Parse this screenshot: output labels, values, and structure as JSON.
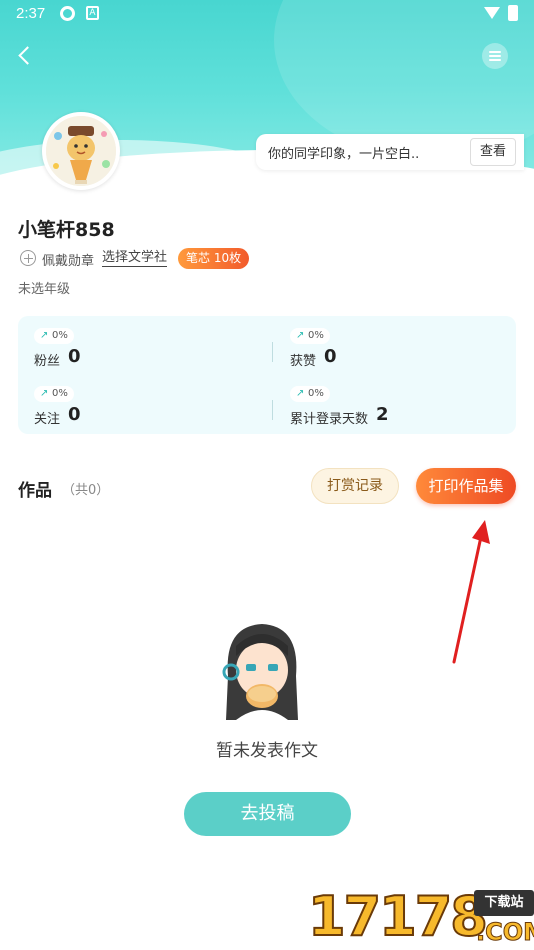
{
  "status_bar": {
    "time": "2:37",
    "app_badge": "A"
  },
  "impression": {
    "text": "你的同学印象，一片空白..",
    "view_label": "查看"
  },
  "profile": {
    "username": "小笔杆858",
    "medal_label": "佩戴勋章",
    "club_link": "选择文学社",
    "pen_badge": "笔芯 10枚",
    "grade": "未选年级"
  },
  "stats": [
    {
      "label": "粉丝",
      "value": "0",
      "trend": "0%"
    },
    {
      "label": "获赞",
      "value": "0",
      "trend": "0%"
    },
    {
      "label": "关注",
      "value": "0",
      "trend": "0%"
    },
    {
      "label": "累计登录天数",
      "value": "2",
      "trend": "0%"
    }
  ],
  "works": {
    "title": "作品",
    "count": "（共0）",
    "reward_button": "打赏记录",
    "print_button": "打印作品集"
  },
  "empty_state": {
    "text": "暂未发表作文",
    "submit_button": "去投稿"
  },
  "watermark": {
    "number": "17178",
    "tag": "下载站",
    "domain": ".COM"
  },
  "colors": {
    "teal": "#48d6d0",
    "orange": "#ee4a24",
    "annotation_arrow": "#e02020"
  }
}
